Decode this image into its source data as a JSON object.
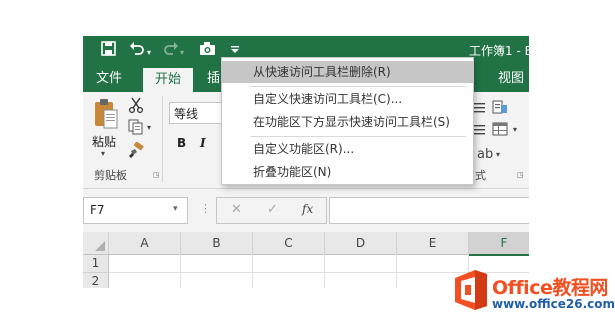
{
  "qat": {
    "save_icon": "save-icon",
    "undo_icon": "undo-icon",
    "redo_icon": "redo-icon",
    "camera_icon": "camera-icon",
    "customize_icon": "customize-qat-icon"
  },
  "title": "工作簿1 - E",
  "tabs": [
    "文件",
    "开始",
    "插",
    "视图"
  ],
  "ribbon": {
    "paste_label": "粘贴",
    "clipboard_group": "剪贴板",
    "font_name": "等线",
    "bold": "B",
    "italic": "I",
    "styles_group_fragment": "式"
  },
  "formula_bar": {
    "name_box": "F7",
    "cancel": "✕",
    "confirm": "✓",
    "fx": "fx",
    "content": ""
  },
  "grid": {
    "columns": [
      "A",
      "B",
      "C",
      "D",
      "E",
      "F"
    ],
    "rows": [
      "1",
      "2"
    ],
    "selected_column": "F"
  },
  "context_menu": {
    "items": [
      "从快速访问工具栏删除(R)",
      "自定义快速访问工具栏(C)...",
      "在功能区下方显示快速访问工具栏(S)",
      "自定义功能区(R)...",
      "折叠功能区(N)"
    ]
  },
  "watermark": {
    "brand": "Office教程网",
    "url": "www.office26.com"
  },
  "colors": {
    "excel_green": "#217346",
    "logo_orange": "#f25022",
    "watermark_blue": "#1e5fa8"
  }
}
